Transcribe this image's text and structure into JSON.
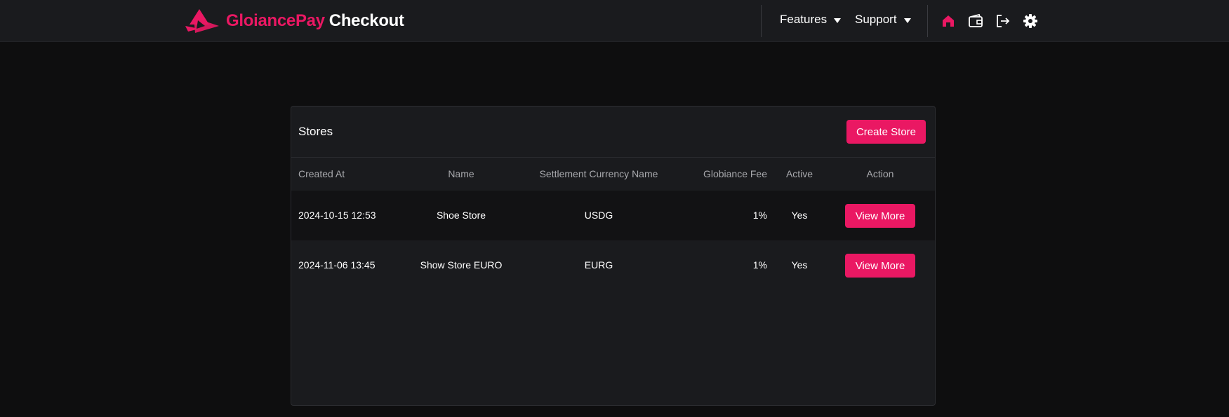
{
  "header": {
    "brand_name": "GloiancePay",
    "brand_product": "Checkout",
    "menus": [
      {
        "label": "Features"
      },
      {
        "label": "Support"
      }
    ],
    "icons": [
      "home-icon",
      "wallet-icon",
      "logout-icon",
      "gear-icon"
    ],
    "accent_color": "#ea1863"
  },
  "stores": {
    "title": "Stores",
    "create_label": "Create Store",
    "columns": {
      "created_at": "Created At",
      "name": "Name",
      "settlement_currency": "Settlement Currency Name",
      "fee": "Globiance Fee",
      "active": "Active",
      "action": "Action"
    },
    "rows": [
      {
        "created_at": "2024-10-15 12:53",
        "name": "Shoe Store",
        "settlement_currency": "USDG",
        "fee": "1%",
        "active": "Yes",
        "action_label": "View More"
      },
      {
        "created_at": "2024-11-06 13:45",
        "name": "Show Store EURO",
        "settlement_currency": "EURG",
        "fee": "1%",
        "active": "Yes",
        "action_label": "View More"
      }
    ]
  }
}
